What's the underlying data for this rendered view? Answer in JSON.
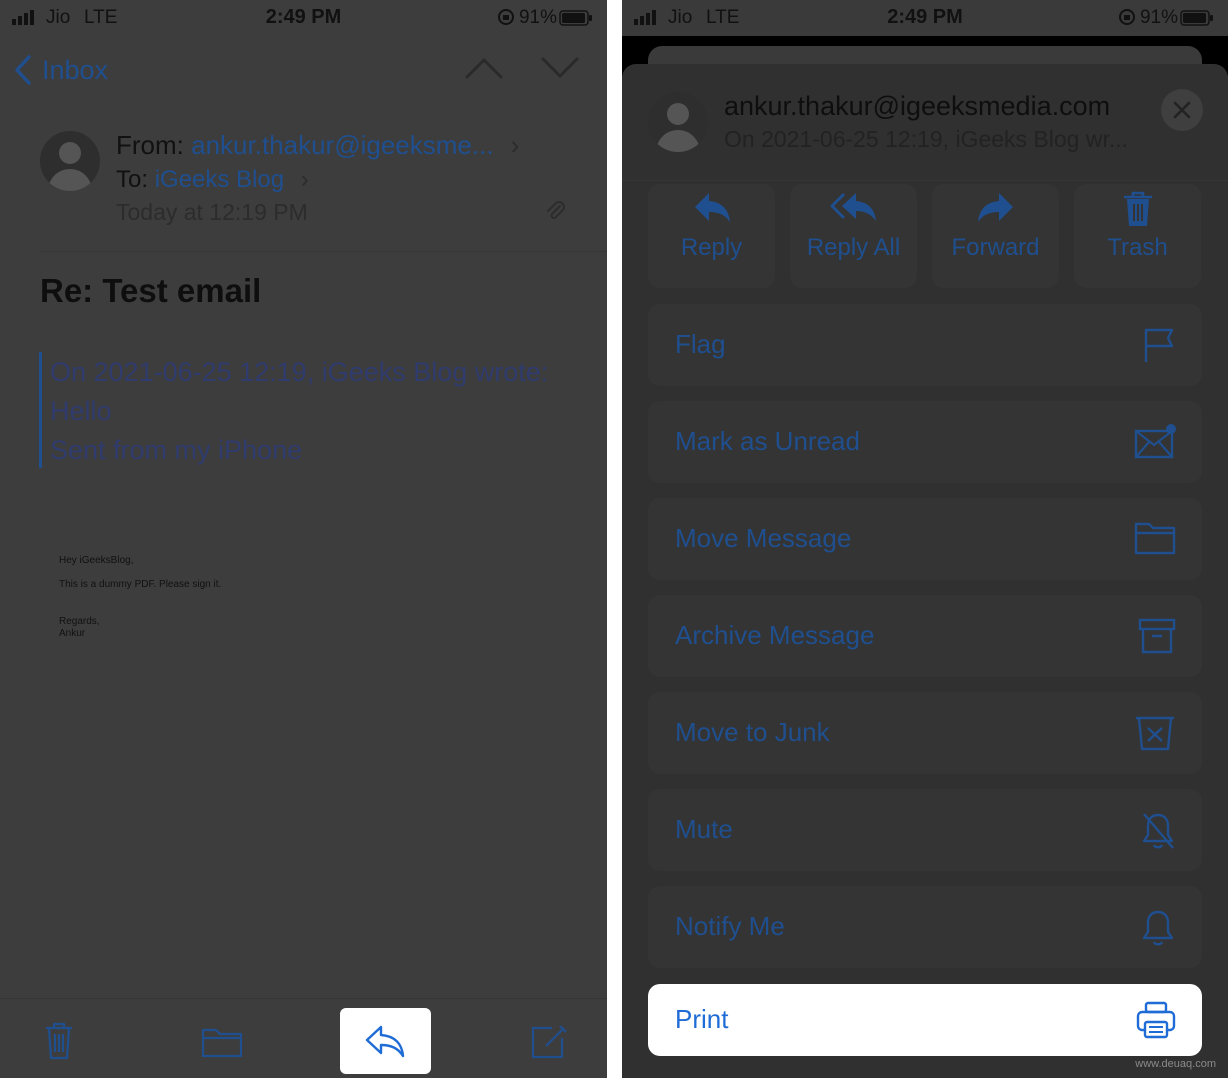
{
  "left": {
    "status": {
      "carrier": "Jio",
      "network": "LTE",
      "time": "2:49 PM",
      "battery": "91%"
    },
    "nav": {
      "back_label": "Inbox"
    },
    "header": {
      "from_label": "From:",
      "from_value": "ankur.thakur@igeeksme...",
      "to_label": "To:",
      "to_value": "iGeeks Blog",
      "date": "Today at 12:19 PM"
    },
    "subject": "Re: Test email",
    "quote": [
      "On 2021-06-25 12:19, iGeeks Blog wrote:",
      "Hello",
      "Sent from my iPhone"
    ],
    "pdf": [
      "Hey iGeeksBlog,",
      "This is a dummy PDF. Please sign it.",
      "Regards,",
      "Ankur"
    ],
    "toolbar": {
      "icons": [
        "trash-icon",
        "folder-icon",
        "reply-icon",
        "compose-icon"
      ]
    }
  },
  "right": {
    "status": {
      "carrier": "Jio",
      "network": "LTE",
      "time": "2:49 PM",
      "battery": "91%"
    },
    "sheet": {
      "email": "ankur.thakur@igeeksmedia.com",
      "subtitle": "On 2021-06-25 12:19, iGeeks Blog wr...",
      "actions": [
        {
          "label": "Reply",
          "icon": "reply-icon"
        },
        {
          "label": "Reply All",
          "icon": "reply-all-icon"
        },
        {
          "label": "Forward",
          "icon": "forward-icon"
        },
        {
          "label": "Trash",
          "icon": "trash-icon"
        }
      ],
      "rows": [
        {
          "label": "Flag",
          "icon": "flag-icon"
        },
        {
          "label": "Mark as Unread",
          "icon": "unread-envelope-icon"
        },
        {
          "label": "Move Message",
          "icon": "folder-icon"
        },
        {
          "label": "Archive Message",
          "icon": "archive-icon"
        },
        {
          "label": "Move to Junk",
          "icon": "junk-icon"
        },
        {
          "label": "Mute",
          "icon": "bell-slash-icon"
        },
        {
          "label": "Notify Me",
          "icon": "bell-icon"
        },
        {
          "label": "Print",
          "icon": "printer-icon"
        }
      ]
    },
    "watermark": "www.deuaq.com"
  },
  "colors": {
    "accent": "#1f6cd6",
    "dim_accent": "#1f4f8f",
    "overlay": "#3d3d3d",
    "highlight": "#ffffff"
  }
}
